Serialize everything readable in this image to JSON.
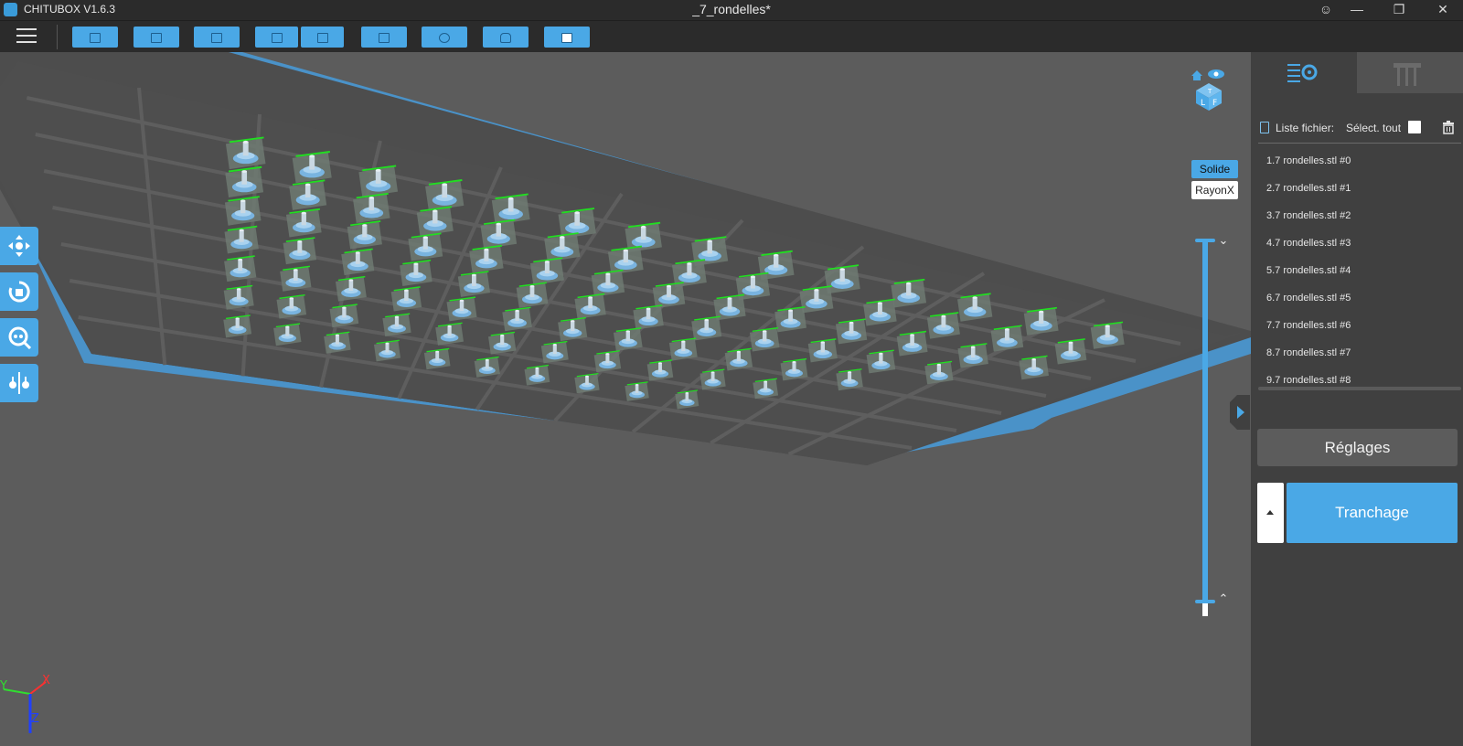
{
  "window": {
    "app_name": "CHITUBOX V1.6.3",
    "document_title": "_7_rondelles*",
    "controls": {
      "account": "☺",
      "minimize": "—",
      "restore": "❐",
      "close": "✕"
    }
  },
  "toolbar": {
    "menu_icon": "hamburger-icon",
    "buttons": [
      {
        "name": "open-file",
        "icon": "folder-open-icon"
      },
      {
        "name": "save",
        "icon": "save-icon"
      },
      {
        "name": "screenshot",
        "icon": "frame-icon"
      },
      {
        "name": "undo",
        "icon": "undo-icon"
      },
      {
        "name": "redo",
        "icon": "redo-icon"
      },
      {
        "name": "model-info",
        "icon": "document-icon"
      },
      {
        "name": "auto-layout",
        "icon": "layout-icon"
      },
      {
        "name": "hollow",
        "icon": "hollow-icon"
      },
      {
        "name": "dig-hole",
        "icon": "hole-icon"
      }
    ]
  },
  "viewport": {
    "view_modes": {
      "solid": "Solide",
      "xray": "RayonX"
    },
    "left_tools": [
      "move-icon",
      "rotate-icon",
      "scale-icon",
      "mirror-icon"
    ],
    "view_cube_faces": [
      "T",
      "L",
      "F"
    ],
    "axis_labels": {
      "x": "X",
      "y": "Y",
      "z": "Z"
    },
    "colors": {
      "plate": "#4d4d4d",
      "frame": "#4a92c8",
      "model": "#79b4e0",
      "support": "#22dd22"
    }
  },
  "panel": {
    "tabs": [
      "settings-list-icon",
      "supports-icon"
    ],
    "file_list": {
      "label": "Liste fichier:",
      "select_all": "Sélect. tout",
      "items": [
        "1.7 rondelles.stl #0",
        "2.7 rondelles.stl #1",
        "3.7 rondelles.stl #2",
        "4.7 rondelles.stl #3",
        "5.7 rondelles.stl #4",
        "6.7 rondelles.stl #5",
        "7.7 rondelles.stl #6",
        "8.7 rondelles.stl #7",
        "9.7 rondelles.stl #8"
      ]
    },
    "settings_button": "Réglages",
    "slice_button": "Tranchage"
  }
}
